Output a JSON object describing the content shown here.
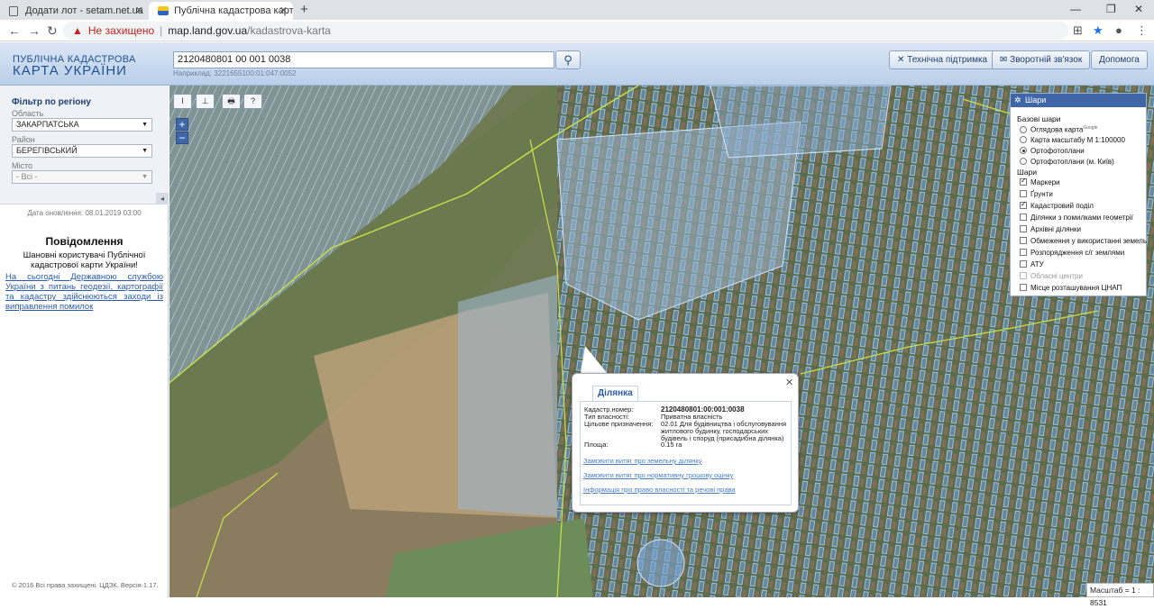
{
  "browser": {
    "tabs": [
      {
        "label": "Додати лот - setam.net.ua",
        "active": false
      },
      {
        "label": "Публічна кадастрова карта Укр",
        "active": true
      }
    ],
    "address": {
      "security": "Не захищено",
      "host": "map.land.gov.ua",
      "path": "/kadastrova-karta"
    }
  },
  "header": {
    "logo_line1": "ПУБЛІЧНА КАДАСТРОВА",
    "logo_line2": "КАРТА УКРАЇНИ",
    "search_value": "2120480801 00 001 0038",
    "search_example": "Наприклад: 3221655100:01:047:0052",
    "buttons": {
      "support": "Технічна підтримка",
      "feedback": "Зворотній зв'язок",
      "help": "Допомога"
    }
  },
  "sidebar": {
    "filter_title": "Фільтр по регіону",
    "oblast_label": "Область",
    "oblast_value": "ЗАКАРПАТСЬКА",
    "raion_label": "Район",
    "raion_value": "БЕРЕГІВСЬКИЙ",
    "misto_label": "Місто",
    "misto_value": "- Всі -",
    "updated": "Дата оновлення: 08.01.2019 03:00",
    "message_title": "Повідомлення",
    "message_body": "Шановні користувачі Публічної кадастрової карти України!",
    "message_link": "На сьогодні Державною службою України з питань геодезії, картографії та кадастру здійснюються заходи із виправлення помилок",
    "copyright": "© 2016 Всі права захищені. ЦДЗК. Версія 1.17."
  },
  "map_tools": {
    "t1": "I",
    "t2": "⊥",
    "t3": "🖶",
    "t4": "?",
    "zoom_in": "+",
    "zoom_out": "−"
  },
  "layers": {
    "title": "Шари",
    "base_title": "Базові шари",
    "base": [
      {
        "label": "Оглядова карта",
        "sup": "Google",
        "on": false
      },
      {
        "label": "Карта масштабу М 1:100000",
        "on": false
      },
      {
        "label": "Ортофотоплани",
        "on": true
      },
      {
        "label": "Ортофотоплани (м. Київ)",
        "on": false
      }
    ],
    "layers_title": "Шари",
    "items": [
      {
        "label": "Маркери",
        "on": true,
        "disabled": false
      },
      {
        "label": "Ґрунти",
        "on": false,
        "disabled": false
      },
      {
        "label": "Кадастровий поділ",
        "on": true,
        "disabled": false
      },
      {
        "label": "Ділянки з помилками геометрії",
        "on": false,
        "disabled": false
      },
      {
        "label": "Архівні ділянки",
        "on": false,
        "disabled": false
      },
      {
        "label": "Обмеження у використанні земель",
        "on": false,
        "disabled": false
      },
      {
        "label": "Розпорядження с/г землями",
        "on": false,
        "disabled": false
      },
      {
        "label": "АТУ",
        "on": false,
        "disabled": false
      },
      {
        "label": "Обласні центри",
        "on": false,
        "disabled": true
      },
      {
        "label": "Місце розташування ЦНАП",
        "on": false,
        "disabled": false
      }
    ]
  },
  "popup": {
    "tab": "Ділянка",
    "rows": [
      {
        "k": "Кадастр.номер:",
        "v": "2120480801:00:001:0038"
      },
      {
        "k": "Тип власності:",
        "v": "Приватна власність"
      },
      {
        "k": "Цільове призначення:",
        "v": "02.01 Для будівництва і обслуговування житлового будинку, господарських будівель і споруд (присадибна ділянка)"
      },
      {
        "k": "Площа:",
        "v": "0.15 га"
      }
    ],
    "links": [
      "Замовити витяг про земельну ділянку",
      "Замовити витяг про нормативну грошову оцінку",
      "Інформація про право власності та речові права"
    ]
  },
  "scale": {
    "label": "Масштаб = 1 : 8531"
  }
}
